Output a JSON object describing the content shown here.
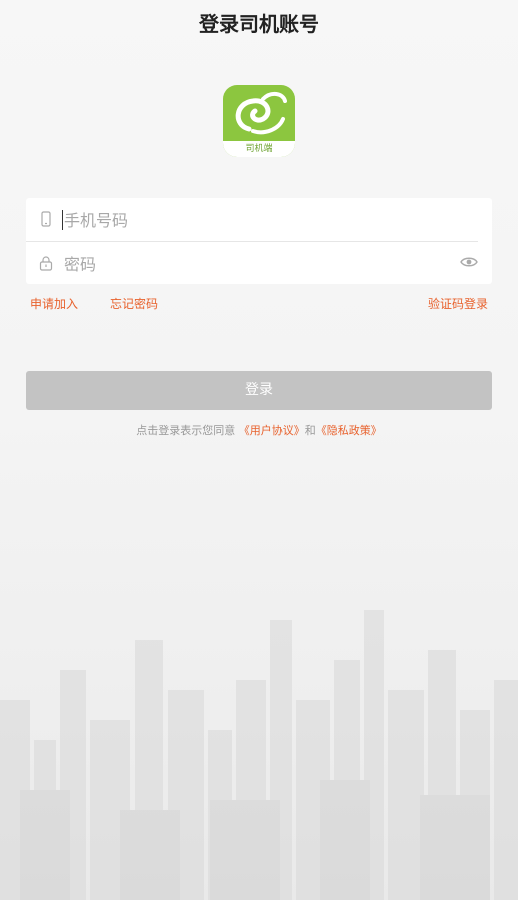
{
  "header": {
    "title": "登录司机账号"
  },
  "logo": {
    "caption": "司机端",
    "brand_color": "#8cc63f"
  },
  "form": {
    "phone_placeholder": "手机号码",
    "password_placeholder": "密码"
  },
  "links": {
    "apply": "申请加入",
    "forgot": "忘记密码",
    "sms_login": "验证码登录"
  },
  "login_button": {
    "label": "登录",
    "color": "#c3c3c3"
  },
  "agreement": {
    "prefix": "点击登录表示您同意",
    "user_agreement": "《用户协议》",
    "conjunction": "和",
    "privacy_policy": "《隐私政策》"
  },
  "accent_color": "#e8612c",
  "icons": {
    "phone": "phone-icon",
    "lock": "lock-icon",
    "eye": "eye-icon"
  }
}
